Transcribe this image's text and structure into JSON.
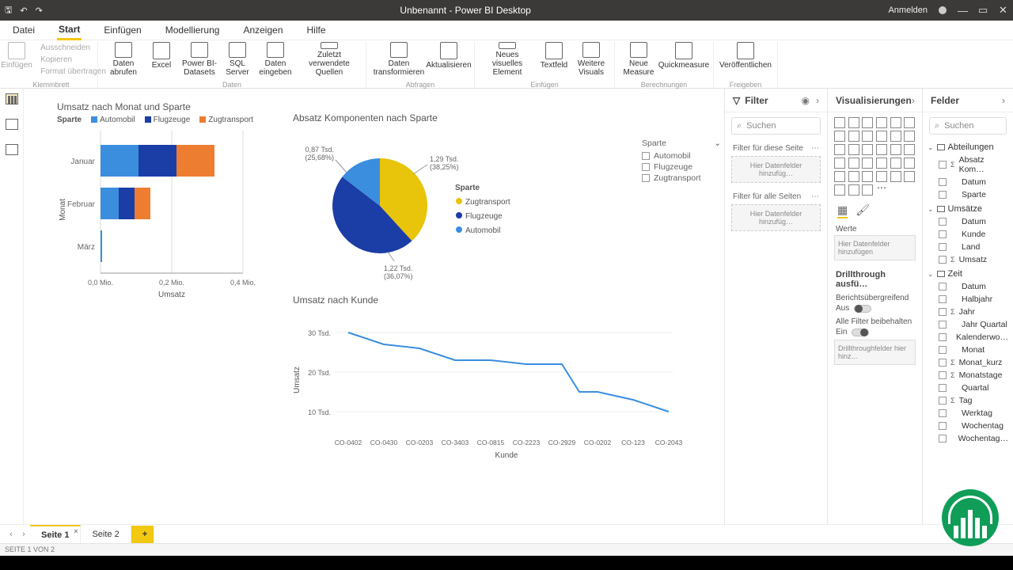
{
  "window": {
    "title": "Unbenannt - Power BI Desktop",
    "signin": "Anmelden"
  },
  "menu": {
    "file": "Datei",
    "start": "Start",
    "insert": "Einfügen",
    "model": "Modellierung",
    "view": "Anzeigen",
    "help": "Hilfe"
  },
  "ribbon": {
    "group_clipboard_label": "Klemmbrett",
    "clipboard_cut": "Ausschneiden",
    "clipboard_copy": "Kopieren",
    "clipboard_format": "Format übertragen",
    "paste_label": "Einfügen",
    "group_data_label": "Daten",
    "daten_abrufen": "Daten abrufen",
    "excel": "Excel",
    "pbi_datasets": "Power BI-Datasets",
    "sql_server": "SQL Server",
    "daten_eingeben": "Daten eingeben",
    "zuletzt_quellen": "Zuletzt verwendete Quellen",
    "group_queries_label": "Abfragen",
    "transform": "Daten transformieren",
    "refresh": "Aktualisieren",
    "group_insert_label": "Einfügen",
    "new_visual": "Neues visuelles Element",
    "textfield": "Textfeld",
    "more_visuals": "Weitere Visuals",
    "group_calc_label": "Berechnungen",
    "new_measure": "Neue Measure",
    "quick_measure": "Quickmeasure",
    "group_share_label": "Freigeben",
    "publish": "Veröffentlichen"
  },
  "filters": {
    "pane_title": "Filter",
    "search_placeholder": "Suchen",
    "this_page": "Filter für diese Seite",
    "all_pages": "Filter für alle Seiten",
    "drop_hint": "Hier Datenfelder hinzufüg…"
  },
  "viz": {
    "pane_title": "Visualisierungen",
    "values_label": "Werte",
    "values_hint": "Hier Datenfelder hinzufügen",
    "drillthrough_title": "Drillthrough ausfü…",
    "crossreport_label": "Berichtsübergreifend",
    "off_label": "Aus",
    "keep_filters_label": "Alle Filter beibehalten",
    "on_label": "Ein",
    "drill_drop_hint": "Drillthroughfelder hier hinz…"
  },
  "fields": {
    "pane_title": "Felder",
    "search_placeholder": "Suchen",
    "tables": [
      {
        "name": "Abteilungen",
        "items": [
          "Absatz Kom…",
          "Datum",
          "Sparte"
        ]
      },
      {
        "name": "Umsätze",
        "items": [
          "Datum",
          "Kunde",
          "Land",
          "Umsatz"
        ]
      },
      {
        "name": "Zeit",
        "items": [
          "Datum",
          "Halbjahr",
          "Jahr",
          "Jahr Quartal",
          "Kalenderwo…",
          "Monat",
          "Monat_kurz",
          "Monatstage",
          "Quartal",
          "Tag",
          "Werktag",
          "Wochentag",
          "Wochentag…"
        ]
      }
    ]
  },
  "slicer": {
    "title": "Sparte",
    "options": [
      "Automobil",
      "Flugzeuge",
      "Zugtransport"
    ]
  },
  "pages": {
    "tab1": "Seite 1",
    "tab2": "Seite 2",
    "status": "SEITE 1 VON 2"
  },
  "chart_data": [
    {
      "type": "bar_stacked_horizontal",
      "title": "Umsatz nach Monat und Sparte",
      "legend_label": "Sparte",
      "xlabel": "Umsatz",
      "ylabel": "Monat",
      "x_ticks": [
        "0,0 Mio.",
        "0,2 Mio.",
        "0,4 Mio."
      ],
      "categories": [
        "Januar",
        "Februar",
        "März"
      ],
      "series": [
        {
          "name": "Automobil",
          "color": "#3b8ede",
          "values": [
            0.1,
            0.05,
            0.002
          ]
        },
        {
          "name": "Flugzeuge",
          "color": "#1b3da6",
          "values": [
            0.1,
            0.04,
            0
          ]
        },
        {
          "name": "Zugtransport",
          "color": "#ed7d31",
          "values": [
            0.1,
            0.04,
            0
          ]
        }
      ],
      "xlim": [
        0,
        0.4
      ]
    },
    {
      "type": "pie",
      "title": "Absatz Komponenten nach Sparte",
      "legend_label": "Sparte",
      "slices": [
        {
          "name": "Zugtransport",
          "value_label": "1,29 Tsd.",
          "pct_label": "(38,25%)",
          "pct": 38.25,
          "color": "#e8c40a"
        },
        {
          "name": "Flugzeuge",
          "value_label": "1,22 Tsd.",
          "pct_label": "(36,07%)",
          "pct": 36.07,
          "color": "#1b3da6"
        },
        {
          "name": "Automobil",
          "value_label": "0,87 Tsd.",
          "pct_label": "(25,68%)",
          "pct": 25.68,
          "color": "#3b8ede"
        }
      ]
    },
    {
      "type": "line",
      "title": "Umsatz nach Kunde",
      "xlabel": "Kunde",
      "ylabel": "Umsatz",
      "y_ticks": [
        "30 Tsd.",
        "20 Tsd.",
        "10 Tsd."
      ],
      "x": [
        "CO-0402",
        "CO-0430",
        "CO-0203",
        "CO-3403",
        "CO-0815",
        "CO-2223",
        "CO-2929",
        "CO-0202",
        "CO-123",
        "CO-2043"
      ],
      "y": [
        30,
        27,
        26,
        23,
        23,
        22,
        22,
        15,
        13,
        10
      ],
      "color": "#3b8ede"
    }
  ]
}
